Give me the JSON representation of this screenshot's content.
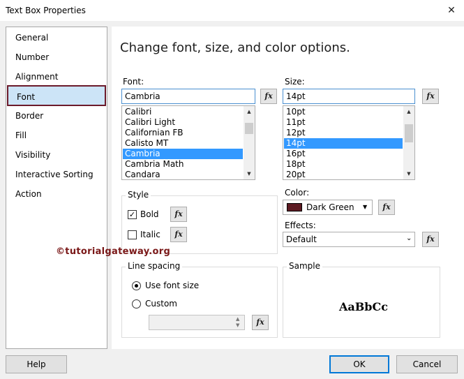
{
  "window": {
    "title": "Text Box Properties",
    "close_glyph": "✕"
  },
  "nav": {
    "items": [
      {
        "label": "General"
      },
      {
        "label": "Number"
      },
      {
        "label": "Alignment"
      },
      {
        "label": "Font"
      },
      {
        "label": "Border"
      },
      {
        "label": "Fill"
      },
      {
        "label": "Visibility"
      },
      {
        "label": "Interactive Sorting"
      },
      {
        "label": "Action"
      }
    ],
    "selected": "Font"
  },
  "heading": "Change font, size, and color options.",
  "font": {
    "label": "Font:",
    "value": "Cambria",
    "options": [
      "Calibri",
      "Calibri Light",
      "Californian FB",
      "Calisto MT",
      "Cambria",
      "Cambria Math",
      "Candara"
    ],
    "selected": "Cambria"
  },
  "size": {
    "label": "Size:",
    "value": "14pt",
    "options": [
      "10pt",
      "11pt",
      "12pt",
      "14pt",
      "16pt",
      "18pt",
      "20pt"
    ],
    "selected": "14pt"
  },
  "fx_label": "fx",
  "style": {
    "legend": "Style",
    "bold": {
      "label": "Bold",
      "checked": true
    },
    "italic": {
      "label": "Italic",
      "checked": false
    }
  },
  "color": {
    "label": "Color:",
    "value": "Dark Green",
    "swatch": "#5c1a22"
  },
  "effects": {
    "label": "Effects:",
    "value": "Default"
  },
  "line_spacing": {
    "legend": "Line spacing",
    "options": [
      {
        "label": "Use font size",
        "selected": true
      },
      {
        "label": "Custom",
        "selected": false
      }
    ],
    "custom_value": ""
  },
  "sample": {
    "legend": "Sample",
    "text": "AaBbCc"
  },
  "watermark": "©tutorialgateway.org",
  "buttons": {
    "help": "Help",
    "ok": "OK",
    "cancel": "Cancel"
  },
  "colors": {
    "selection": "#3399ff",
    "nav_selected_bg": "#cce4f7",
    "nav_selected_border": "#6b1a2a",
    "accent": "#0078d7"
  }
}
